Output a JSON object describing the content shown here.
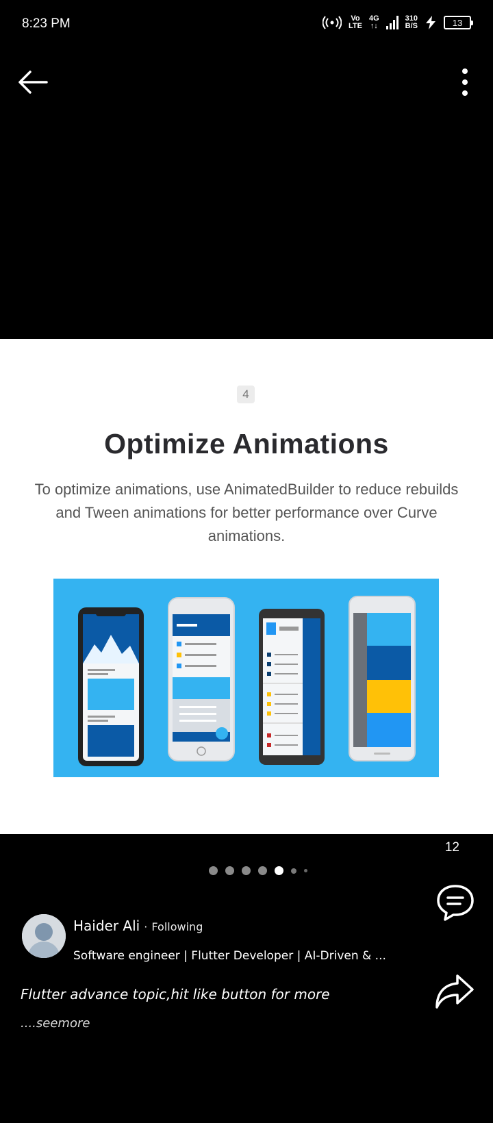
{
  "status_bar": {
    "time": "8:23 PM",
    "volte_top": "Vo",
    "volte_bottom": "LTE",
    "network": "4G",
    "speed_value": "310",
    "speed_unit": "B/S",
    "battery": "13",
    "icons": [
      "hotspot-icon",
      "signal-icon",
      "charging-icon",
      "battery-icon"
    ]
  },
  "toolbar": {
    "icons": [
      "back-arrow-icon",
      "more-vertical-icon"
    ]
  },
  "slide": {
    "number": "4",
    "title": "Optimize Animations",
    "description": "To optimize animations, use AnimatedBuilder to reduce rebuilds and Tween animations for better performance over Curve animations.",
    "illustration": {
      "background": "#34b3f1",
      "colors": [
        "#0b5aa6",
        "#ffc107",
        "#2196f3",
        "#1565c0"
      ]
    }
  },
  "carousel": {
    "counter": "12",
    "total_dots": 7,
    "active_dot": 5
  },
  "post": {
    "author_name": "Haider Ali",
    "separator": "·",
    "follow_status": "Following",
    "headline": "Software engineer | Flutter Developer | AI-Driven & ...",
    "text": "Flutter advance topic,hit like button for more",
    "see_more": "....seemore"
  },
  "actions": {
    "icons": [
      "comment-icon",
      "share-icon"
    ]
  }
}
